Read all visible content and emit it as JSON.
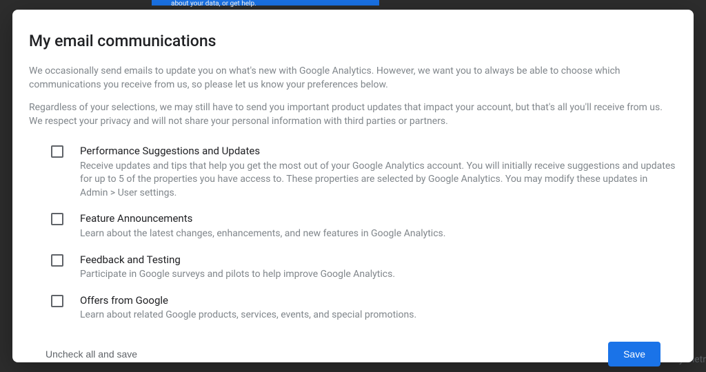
{
  "background": {
    "top_banner_hint": "about your data, or get help.",
    "right_text_hint": "access your key metr"
  },
  "modal": {
    "title": "My email communications",
    "description_1": "We occasionally send emails to update you on what's new with Google Analytics. However, we want you to always be able to choose which communications you receive from us, so please let us know your preferences below.",
    "description_2": "Regardless of your selections, we may still have to send you important product updates that impact your account, but that's all you'll receive from us. We respect your privacy and will not share your personal information with third parties or partners.",
    "options": [
      {
        "title": "Performance Suggestions and Updates",
        "desc": "Receive updates and tips that help you get the most out of your Google Analytics account. You will initially receive suggestions and updates for up to 5 of the properties you have access to. These properties are selected by Google Analytics. You may modify these updates in Admin > User settings."
      },
      {
        "title": "Feature Announcements",
        "desc": "Learn about the latest changes, enhancements, and new features in Google Analytics."
      },
      {
        "title": "Feedback and Testing",
        "desc": "Participate in Google surveys and pilots to help improve Google Analytics."
      },
      {
        "title": "Offers from Google",
        "desc": "Learn about related Google products, services, events, and special promotions."
      }
    ],
    "uncheck_label": "Uncheck all and save",
    "save_label": "Save"
  }
}
